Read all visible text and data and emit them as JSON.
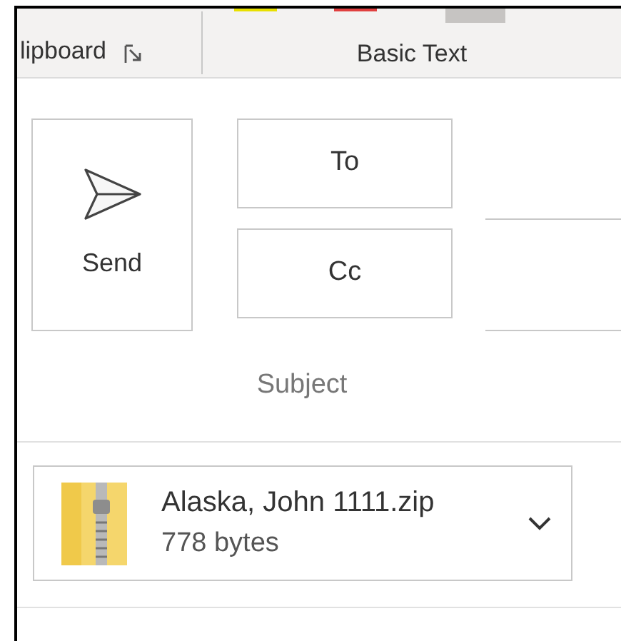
{
  "ribbon": {
    "groups": [
      {
        "label": "lipboard"
      },
      {
        "label": "Basic Text"
      }
    ]
  },
  "compose": {
    "send_button": "Send",
    "to_button": "To",
    "cc_button": "Cc",
    "subject_label": "Subject"
  },
  "attachment": {
    "name": "Alaska, John 1111.zip",
    "size": "778 bytes"
  }
}
